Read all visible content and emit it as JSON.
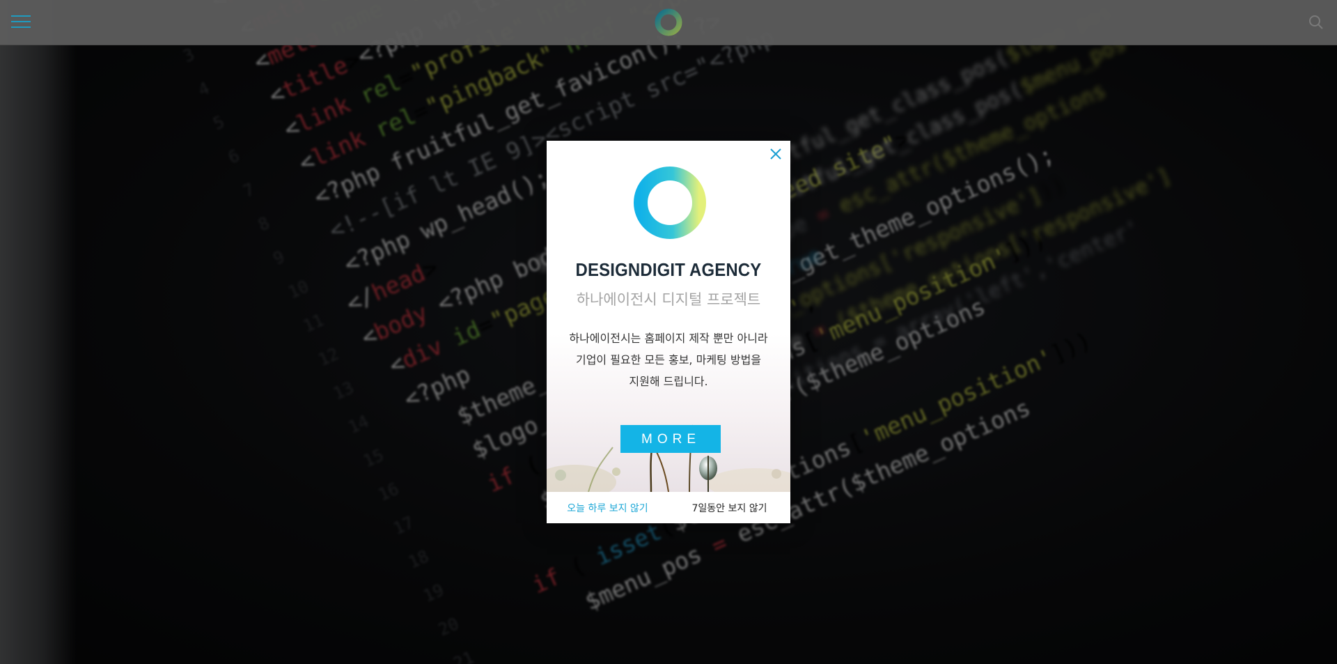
{
  "header": {
    "menu_icon": "hamburger-icon",
    "logo_icon": "ring-logo-icon",
    "search_icon": "search-icon"
  },
  "popup": {
    "close_icon": "close-icon",
    "logo_icon": "ring-logo-icon",
    "brand": "DESIGNDIGIT AGENCY",
    "subtitle": "하나에이전시 디지털 프로젝트",
    "description_lines": [
      "하나에이전시는 홈페이지 제작 뿐만 아니라",
      "기업이 필요한 모든 홍보, 마케팅 방법을",
      "지원해 드립니다."
    ],
    "more_label": "MORE",
    "footer": {
      "hide_today": "오늘 하루 보지 않기",
      "hide_week": "7일동안 보지 않기"
    }
  },
  "colors": {
    "accent": "#14b4e6",
    "brand_text": "#1c2b38",
    "header_bg": "#5c5c5c",
    "ring_gradient": [
      "#14b4e6",
      "#d8ee7a"
    ]
  }
}
